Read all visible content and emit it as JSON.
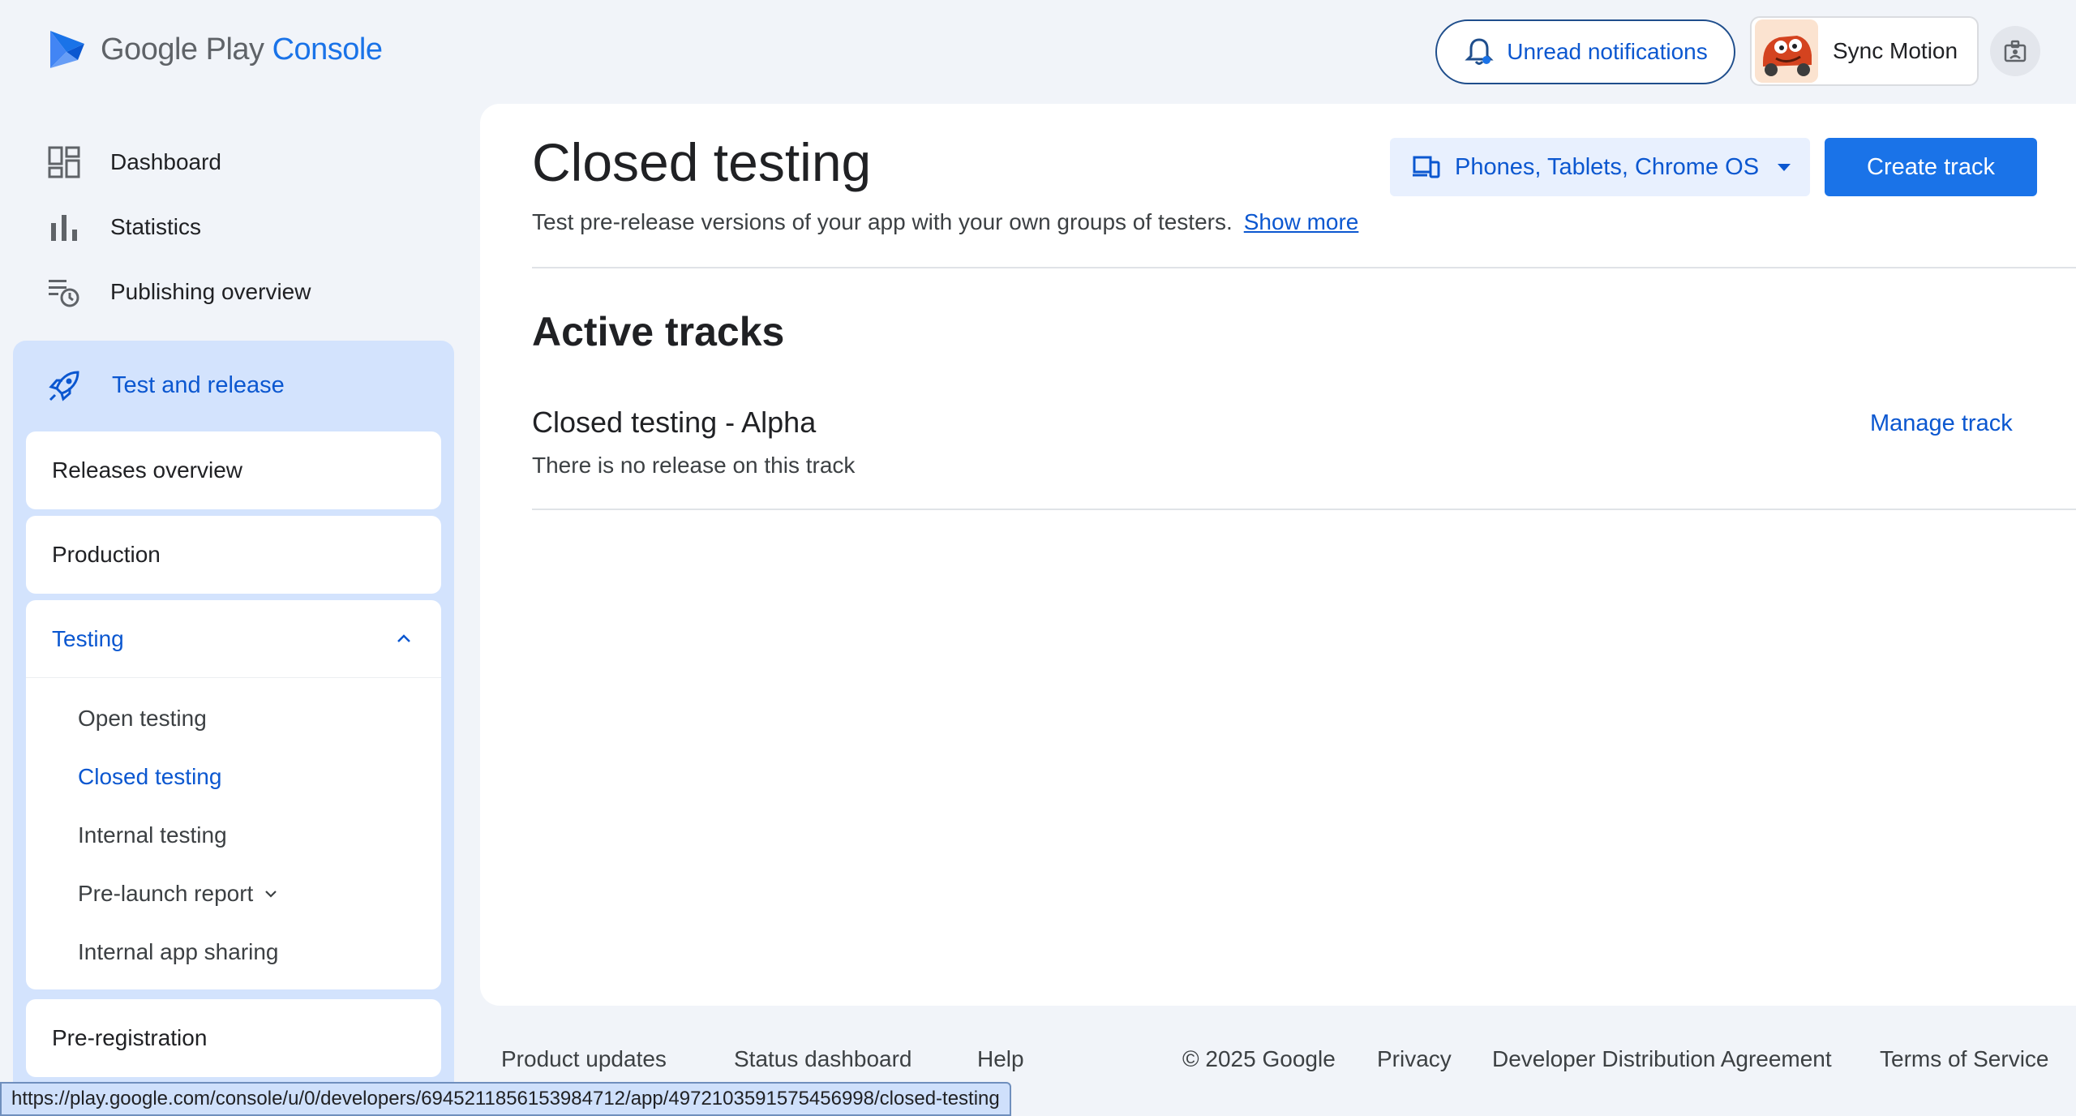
{
  "logo": {
    "brand": "Google Play",
    "product": "Console"
  },
  "header": {
    "notifications_label": "Unread notifications",
    "account_name": "Sync Motion"
  },
  "sidebar": {
    "top_items": [
      {
        "label": "Dashboard",
        "icon": "dashboard-icon"
      },
      {
        "label": "Statistics",
        "icon": "bar-chart-icon"
      },
      {
        "label": "Publishing overview",
        "icon": "publishing-icon"
      }
    ],
    "section": {
      "label": "Test and release",
      "icon": "rocket-icon",
      "items": {
        "releases_overview": "Releases overview",
        "production": "Production",
        "testing": "Testing",
        "testing_sub": [
          "Open testing",
          "Closed testing",
          "Internal testing",
          "Pre-launch report",
          "Internal app sharing"
        ],
        "pre_registration": "Pre-registration"
      }
    }
  },
  "main": {
    "title": "Closed testing",
    "description": "Test pre-release versions of your app with your own groups of testers.",
    "show_more": "Show more",
    "device_filter": "Phones, Tablets, Chrome OS",
    "create_button": "Create track",
    "section_title": "Active tracks",
    "track": {
      "name": "Closed testing - Alpha",
      "status": "There is no release on this track",
      "action": "Manage track"
    }
  },
  "footer": {
    "product_updates": "Product updates",
    "status_dashboard": "Status dashboard",
    "help": "Help",
    "copyright": "© 2025 Google",
    "privacy": "Privacy",
    "dda": "Developer Distribution Agreement",
    "tos": "Terms of Service"
  },
  "status_url": "https://play.google.com/console/u/0/developers/6945211856153984712/app/4972103591575456998/closed-testing",
  "colors": {
    "accent": "#1a73e8",
    "link": "#0b57d0",
    "sidebar_selected": "#d3e3fd",
    "background": "#f1f4f9"
  }
}
